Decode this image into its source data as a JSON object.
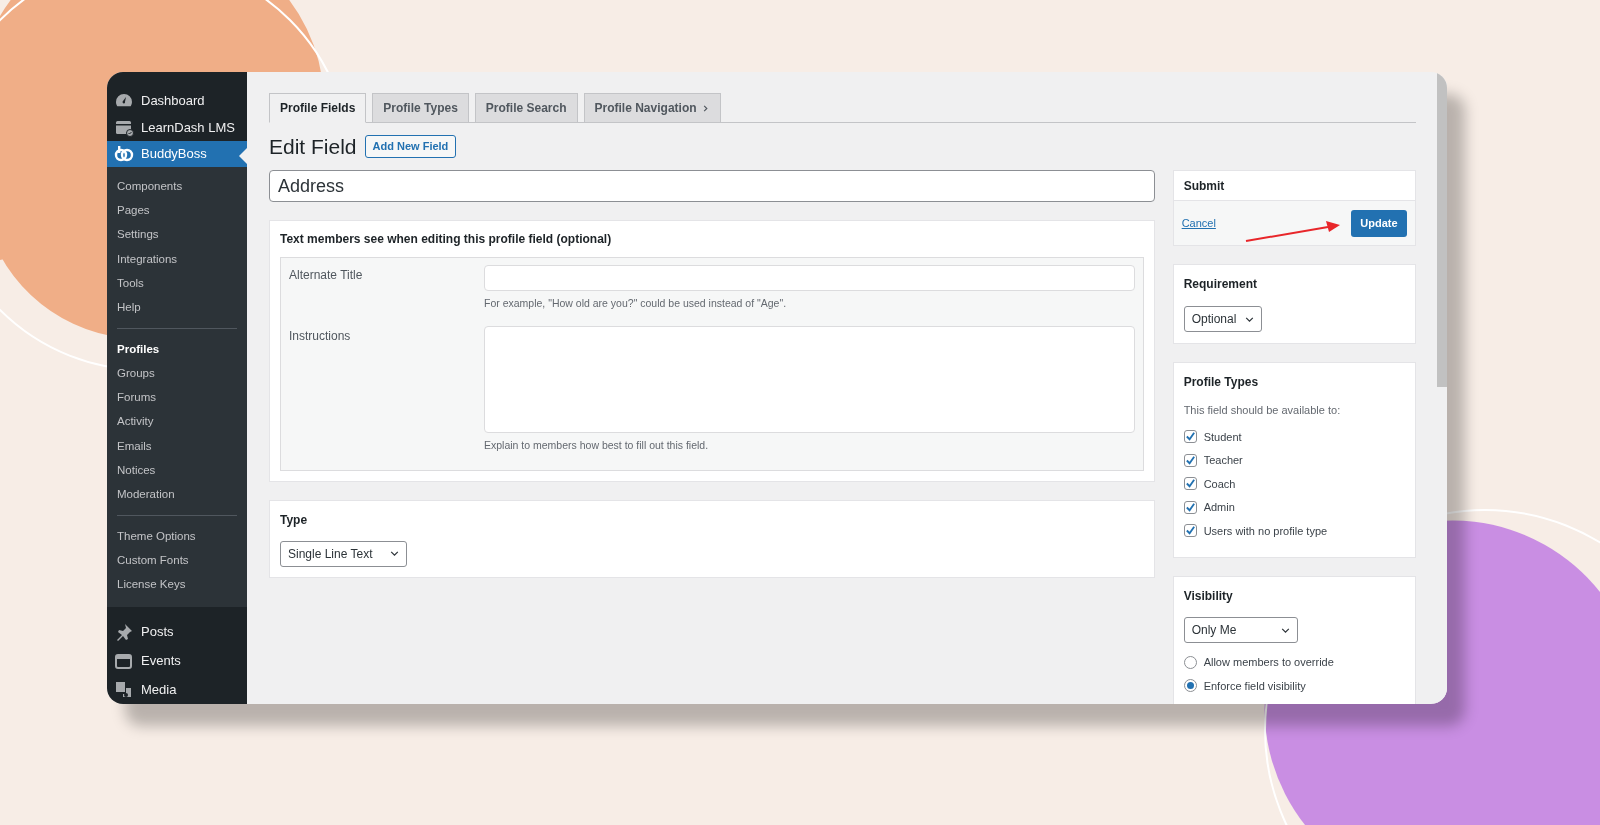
{
  "sidebar": {
    "menu": [
      {
        "label": "Dashboard",
        "selected": false
      },
      {
        "label": "LearnDash LMS",
        "selected": false
      },
      {
        "label": "BuddyBoss",
        "selected": true
      }
    ],
    "submenu_groups": [
      [
        {
          "label": "Components",
          "selected": false
        },
        {
          "label": "Pages",
          "selected": false
        },
        {
          "label": "Settings",
          "selected": false
        },
        {
          "label": "Integrations",
          "selected": false
        },
        {
          "label": "Tools",
          "selected": false
        },
        {
          "label": "Help",
          "selected": false
        }
      ],
      [
        {
          "label": "Profiles",
          "selected": true
        },
        {
          "label": "Groups",
          "selected": false
        },
        {
          "label": "Forums",
          "selected": false
        },
        {
          "label": "Activity",
          "selected": false
        },
        {
          "label": "Emails",
          "selected": false
        },
        {
          "label": "Notices",
          "selected": false
        },
        {
          "label": "Moderation",
          "selected": false
        }
      ],
      [
        {
          "label": "Theme Options",
          "selected": false
        },
        {
          "label": "Custom Fonts",
          "selected": false
        },
        {
          "label": "License Keys",
          "selected": false
        }
      ]
    ],
    "menu_after": [
      {
        "label": "Posts",
        "selected": false
      },
      {
        "label": "Events",
        "selected": false
      },
      {
        "label": "Media",
        "selected": false
      }
    ]
  },
  "tabs": [
    {
      "label": "Profile Fields",
      "selected": true
    },
    {
      "label": "Profile Types",
      "selected": false
    },
    {
      "label": "Profile Search",
      "selected": false
    },
    {
      "label": "Profile Navigation",
      "selected": false
    }
  ],
  "heading": "Edit Field",
  "add_new_button": "Add New Field",
  "field_name": {
    "value": "Address"
  },
  "member_text_box": {
    "title": "Text members see when editing this profile field (optional)",
    "rows": [
      {
        "label": "Alternate Title",
        "kind": "input",
        "hint": "For example, \"How old are you?\" could be used instead of \"Age\"."
      },
      {
        "label": "Instructions",
        "kind": "textarea",
        "hint": "Explain to members how best to fill out this field."
      }
    ]
  },
  "type_box": {
    "title": "Type",
    "select": "Single Line Text"
  },
  "submit_box": {
    "title": "Submit",
    "cancel": "Cancel",
    "update": "Update"
  },
  "requirement_box": {
    "title": "Requirement",
    "select": "Optional"
  },
  "profile_types_box": {
    "title": "Profile Types",
    "description": "This field should be available to:",
    "options": [
      {
        "label": "Student",
        "checked": true
      },
      {
        "label": "Teacher",
        "checked": true
      },
      {
        "label": "Coach",
        "checked": true
      },
      {
        "label": "Admin",
        "checked": true
      },
      {
        "label": "Users with no profile type",
        "checked": true
      }
    ]
  },
  "visibility_box": {
    "title": "Visibility",
    "select": "Only Me",
    "options": [
      {
        "label": "Allow members to override",
        "selected": false
      },
      {
        "label": "Enforce field visibility",
        "selected": true
      }
    ]
  }
}
